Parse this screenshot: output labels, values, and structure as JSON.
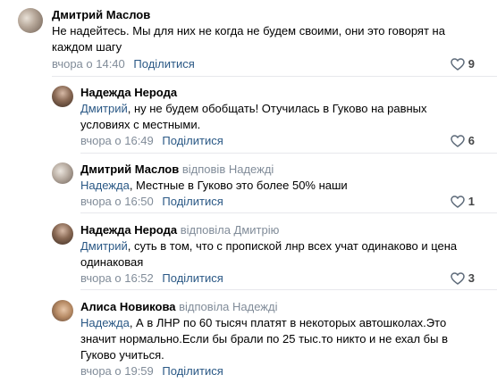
{
  "colors": {
    "link": "#2a5885",
    "meta_gray": "#818c99",
    "divider": "#e7e8ec"
  },
  "comments": [
    {
      "author": "Дмитрий Маслов",
      "reply_to": "",
      "mention": "",
      "text": "Не надейтесь. Мы для них не когда не будем своими, они это говорят на каждом шагу",
      "time": "вчора о 14:40",
      "share_label": "Поділитися",
      "like_icon": "heart-outline-icon",
      "likes": "9"
    },
    {
      "author": "Надежда Нерода",
      "reply_to": "",
      "mention": "Дмитрий",
      "text": ", ну не будем обобщать! Отучилась в Гуково на равных условиях с местными.",
      "time": "вчора о 16:49",
      "share_label": "Поділитися",
      "like_icon": "heart-outline-icon",
      "likes": "6"
    },
    {
      "author": "Дмитрий Маслов",
      "reply_to": "відповів Надеждi",
      "mention": "Надежда",
      "text": ", Местные в Гуково это более 50% наши",
      "time": "вчора о 16:50",
      "share_label": "Поділитися",
      "like_icon": "heart-outline-icon",
      "likes": "1"
    },
    {
      "author": "Надежда Нерода",
      "reply_to": "відповіла Дмитрію",
      "mention": "Дмитрий",
      "text": ", суть в том, что с пропиской лнр всех учат одинаково и цена одинаковая",
      "time": "вчора о 16:52",
      "share_label": "Поділитися",
      "like_icon": "heart-outline-icon",
      "likes": "3"
    },
    {
      "author": "Алиса Новикова",
      "reply_to": "відповіла Надеждi",
      "mention": "Надежда",
      "text": ", А в ЛНР по 60 тысяч платят в некоторых автошколах.Это значит нормально.Если бы брали по 25 тыс.то никто и не ехал бы в Гуково учиться.",
      "time": "вчора о 19:59",
      "share_label": "Поділитися"
    }
  ]
}
